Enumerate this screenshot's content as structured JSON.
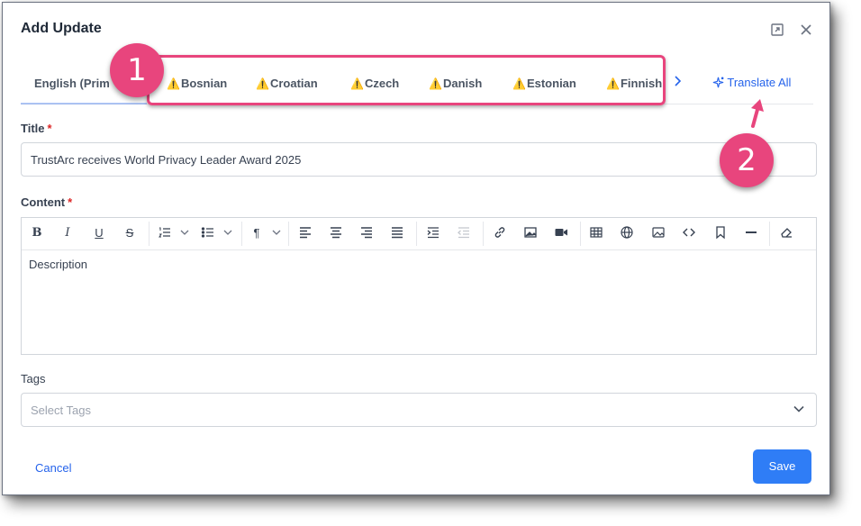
{
  "modal": {
    "title": "Add Update",
    "expand_icon": "expand-icon",
    "close_icon": "close-icon"
  },
  "tabs": {
    "items": [
      {
        "label": "English (Prim",
        "warning": false,
        "active": true
      },
      {
        "label": "Bosnian",
        "warning": true
      },
      {
        "label": "Croatian",
        "warning": true
      },
      {
        "label": "Czech",
        "warning": true
      },
      {
        "label": "Danish",
        "warning": true
      },
      {
        "label": "Estonian",
        "warning": true
      },
      {
        "label": "Finnish",
        "warning": true
      }
    ],
    "warning_glyph": "⚠️",
    "next_icon": "chevron-right-icon",
    "translate_all_label": "Translate All",
    "translate_icon": "sparkle-icon"
  },
  "annotations": {
    "badge_1": "1",
    "badge_2": "2",
    "color": "#e8457d"
  },
  "form": {
    "title_label": "Title",
    "title_value": "TrustArc receives World Privacy Leader Award 2025",
    "content_label": "Content",
    "required_mark": "*",
    "content_text": "Description",
    "tags_label": "Tags",
    "tags_placeholder": "Select Tags"
  },
  "toolbar": {
    "bold": "B",
    "italic": "I",
    "underline": "U",
    "strike": "S",
    "paragraph": "¶"
  },
  "footer": {
    "cancel_label": "Cancel",
    "save_label": "Save"
  },
  "colors": {
    "accent": "#2563eb",
    "save_button": "#2f7df6",
    "required": "#dc2626"
  }
}
